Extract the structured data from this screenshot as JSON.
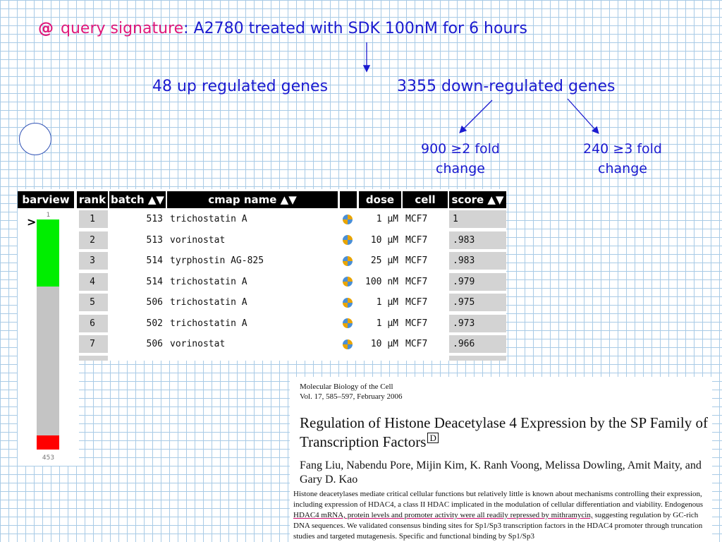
{
  "query": {
    "at_symbol": "@",
    "label": "query signature",
    "colon": ":",
    "description": "A2780 treated with SDK 100nM for 6 hours"
  },
  "genes": {
    "up": "48 up regulated genes",
    "down": "3355 down-regulated genes"
  },
  "fold": {
    "two_line1": "900 ≥2 fold",
    "two_line2": "change",
    "three_line1": "240 ≥3 fold",
    "three_line2": "change"
  },
  "table": {
    "headers": {
      "barview": "barview",
      "rank": "rank",
      "batch": "batch ▲▼",
      "cmap_name": "cmap name ▲▼",
      "dose": "dose",
      "cell": "cell",
      "score": "score ▲▼"
    },
    "rows": [
      {
        "rank": "1",
        "batch": "513",
        "name": "trichostatin A",
        "dose": "1 µM",
        "cell": "MCF7",
        "score": "1"
      },
      {
        "rank": "2",
        "batch": "513",
        "name": "vorinostat",
        "dose": "10 µM",
        "cell": "MCF7",
        "score": ".983"
      },
      {
        "rank": "3",
        "batch": "514",
        "name": "tyrphostin AG-825",
        "dose": "25 µM",
        "cell": "MCF7",
        "score": ".983"
      },
      {
        "rank": "4",
        "batch": "514",
        "name": "trichostatin A",
        "dose": "100 nM",
        "cell": "MCF7",
        "score": ".979"
      },
      {
        "rank": "5",
        "batch": "506",
        "name": "trichostatin A",
        "dose": "1 µM",
        "cell": "MCF7",
        "score": ".975"
      },
      {
        "rank": "6",
        "batch": "502",
        "name": "trichostatin A",
        "dose": "1 µM",
        "cell": "MCF7",
        "score": ".973"
      },
      {
        "rank": "7",
        "batch": "506",
        "name": "vorinostat",
        "dose": "10 µM",
        "cell": "MCF7",
        "score": ".966"
      }
    ]
  },
  "barview": {
    "top_number": "1",
    "bottom_number": "453",
    "pointer": ">",
    "positive_fraction": 0.29,
    "negative_fraction": 0.06,
    "positive_color": "#00ee00",
    "negative_color": "#ff0000",
    "neutral_color": "#c4c4c4"
  },
  "paper": {
    "journal": "Molecular Biology of the Cell",
    "volume": "Vol. 17, 585–597, February 2006",
    "title": "Regulation of Histone Deacetylase 4 Expression by the SP Family of Transcription Factors",
    "title_badge": "D",
    "authors": "Fang Liu, Nabendu Pore, Mijin Kim, K. Ranh Voong, Melissa Dowling, Amit Maity, and Gary D. Kao",
    "abstract_before": "Histone deacetylases mediate critical cellular functions but relatively little is known about mechanisms controlling their expression, including expression of HDAC4, a class II HDAC implicated in the modulation of cellular differentiation and viability. Endogenous ",
    "abstract_highlight": "HDAC4 mRNA, protein levels and promoter activity were all readily repressed by mithramycin,",
    "abstract_after": " suggesting regulation by GC-rich DNA sequences. We validated consensus binding sites for Sp1/Sp3 transcription factors in the HDAC4 promoter through truncation studies and targeted mutagenesis. Specific and functional binding by Sp1/Sp3"
  },
  "colors": {
    "accent_blue": "#1b1bd0",
    "accent_pink": "#e0187a",
    "grid": "#a9cbe6"
  }
}
